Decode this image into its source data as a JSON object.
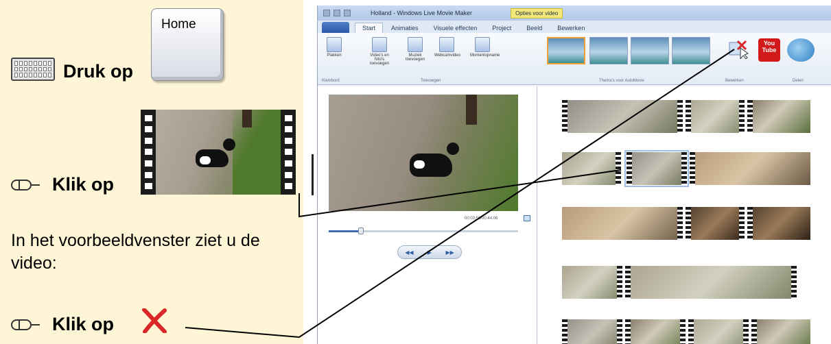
{
  "instructions": {
    "step1": {
      "text": "Druk op",
      "key_label": "Home"
    },
    "step2": {
      "text": "Klik op"
    },
    "paragraph": "In het voorbeeldvenster ziet u de video:",
    "step3": {
      "text": "Klik op"
    }
  },
  "movie_maker": {
    "window_title": "Holland - Windows Live Movie Maker",
    "context_tab": "Opties voor video",
    "tabs": [
      "Start",
      "Animaties",
      "Visuele effecten",
      "Project",
      "Beeld",
      "Bewerken"
    ],
    "ribbon": {
      "buttons": [
        {
          "label": "Plakken"
        },
        {
          "label": "Video's en foto's toevoegen"
        },
        {
          "label": "Muziek toevoegen"
        },
        {
          "label": "Webcamvideo"
        },
        {
          "label": "Momentopname"
        }
      ],
      "groups": [
        "Klembord",
        "Toevoegen",
        "Thema's voor AutoMovie",
        "Bewerken",
        "Delen"
      ],
      "share": {
        "youtube": "You Tube",
        "skydrive": "SkyDrive"
      }
    },
    "preview": {
      "timecode": "00:03,56/00:44,06",
      "progress": 0.17
    },
    "colors": {
      "accent": "#3e6fb5",
      "selected_theme": "#f0a030",
      "panel": "#fdf5d6",
      "delete_x": "#d92626"
    }
  }
}
